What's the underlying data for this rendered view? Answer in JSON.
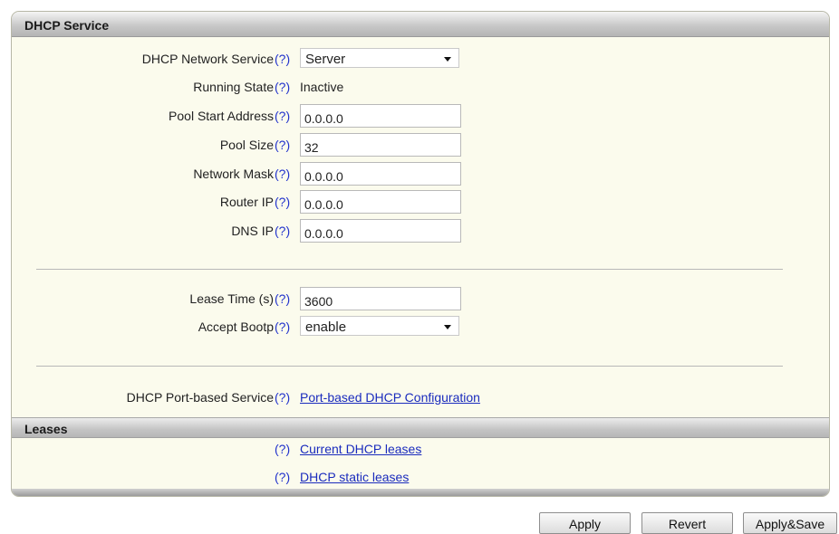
{
  "panel": {
    "title": "DHCP Service"
  },
  "help_marker": "(?)",
  "fields": {
    "network_service": {
      "label": "DHCP Network Service",
      "value": "Server"
    },
    "running_state": {
      "label": "Running State",
      "value": "Inactive"
    },
    "pool_start": {
      "label": "Pool Start Address",
      "value": "0.0.0.0"
    },
    "pool_size": {
      "label": "Pool Size",
      "value": "32"
    },
    "network_mask": {
      "label": "Network Mask",
      "value": "0.0.0.0"
    },
    "router_ip": {
      "label": "Router IP",
      "value": "0.0.0.0"
    },
    "dns_ip": {
      "label": "DNS IP",
      "value": "0.0.0.0"
    },
    "lease_time": {
      "label": "Lease Time (s)",
      "value": "3600"
    },
    "accept_bootp": {
      "label": "Accept Bootp",
      "value": "enable"
    },
    "port_based": {
      "label": "DHCP Port-based Service",
      "link": "Port-based DHCP Configuration"
    }
  },
  "leases": {
    "title": "Leases",
    "current_link": "Current DHCP leases",
    "static_link": "DHCP static leases"
  },
  "buttons": {
    "apply": "Apply",
    "revert": "Revert",
    "apply_save": "Apply&Save"
  }
}
